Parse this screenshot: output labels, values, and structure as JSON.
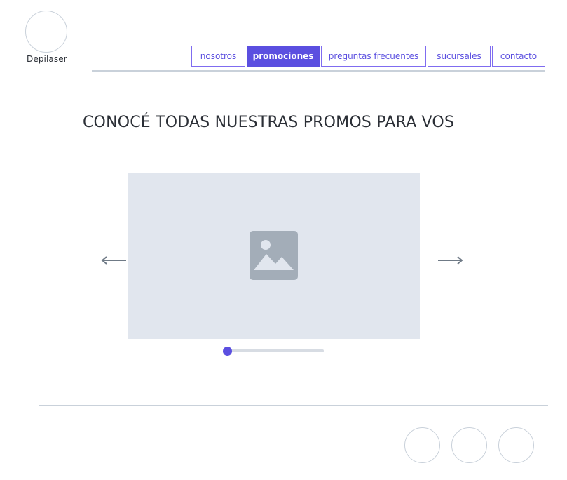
{
  "brand": {
    "name": "Depilaser"
  },
  "nav": {
    "items": [
      {
        "label": "nosotros",
        "active": false
      },
      {
        "label": "promociones",
        "active": true
      },
      {
        "label": "preguntas frecuentes",
        "active": false
      },
      {
        "label": "sucursales",
        "active": false
      },
      {
        "label": "contacto",
        "active": false
      }
    ]
  },
  "main": {
    "heading": "CONOCÉ TODAS NUESTRAS PROMOS PARA VOS"
  },
  "carousel": {
    "prev_icon": "arrow-left-icon",
    "next_icon": "arrow-right-icon",
    "slide_icon": "image-placeholder-icon",
    "progress": 0.0
  },
  "footer": {
    "social_icons": [
      "social-icon-1",
      "social-icon-2",
      "social-icon-3"
    ]
  },
  "colors": {
    "accent": "#5b4fe0",
    "line": "#c9d1da",
    "placeholder_bg": "#e1e6ee",
    "placeholder_icon": "#a3adb8",
    "text": "#2b2f36"
  }
}
